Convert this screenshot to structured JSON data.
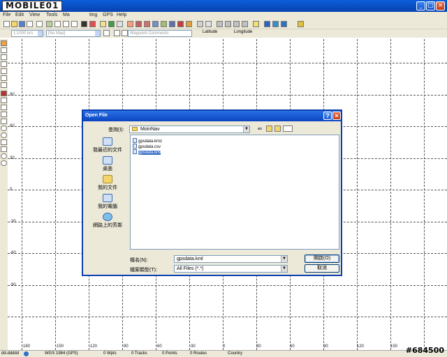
{
  "app": {
    "logo_text": "MOBILE01",
    "menu": [
      "File",
      "Edit",
      "View",
      "Tools",
      "Ma",
      "ting",
      "GPS",
      "Help"
    ]
  },
  "toolbar2": {
    "scale_combo": "1:1000 km",
    "map_combo": "[No Map]",
    "waypoint_comments": "Waypoint Comments",
    "latitude_label": "Latitude",
    "longitude_label": "Longitude"
  },
  "map": {
    "lat_labels": [
      "90",
      "60",
      "30",
      "0",
      "-30",
      "-60",
      "-90"
    ],
    "lon_labels": [
      "-180",
      "-150",
      "-120",
      "-90",
      "-60",
      "-30",
      "0",
      "30",
      "60",
      "90",
      "120",
      "150"
    ]
  },
  "status": {
    "format": "dd.ddddd",
    "datum": "WGS 1984 (GPS)",
    "wpts": "0 Wpts",
    "tracks": "0 Tracks",
    "points": "0 Points",
    "routes": "0 Routes",
    "country": "Country"
  },
  "watermark": "#684500",
  "dialog": {
    "title": "Open File",
    "look_in_label": "查詢(I):",
    "look_in_value": "MoinNav",
    "places": [
      "我最近的文件",
      "桌面",
      "我的文件",
      "我的電腦",
      "網路上的芳鄰"
    ],
    "files": [
      "gpsdata.kmz",
      "gpsdata.csv",
      "gpsdata.kml"
    ],
    "selected_file": "gpsdata.kml",
    "filename_label": "檔名(N):",
    "filename_value": "gpsdata.kml",
    "filetype_label": "檔案類型(T):",
    "filetype_value": "All Files (*.*)",
    "open_button": "開啟(O)",
    "cancel_button": "取消"
  }
}
